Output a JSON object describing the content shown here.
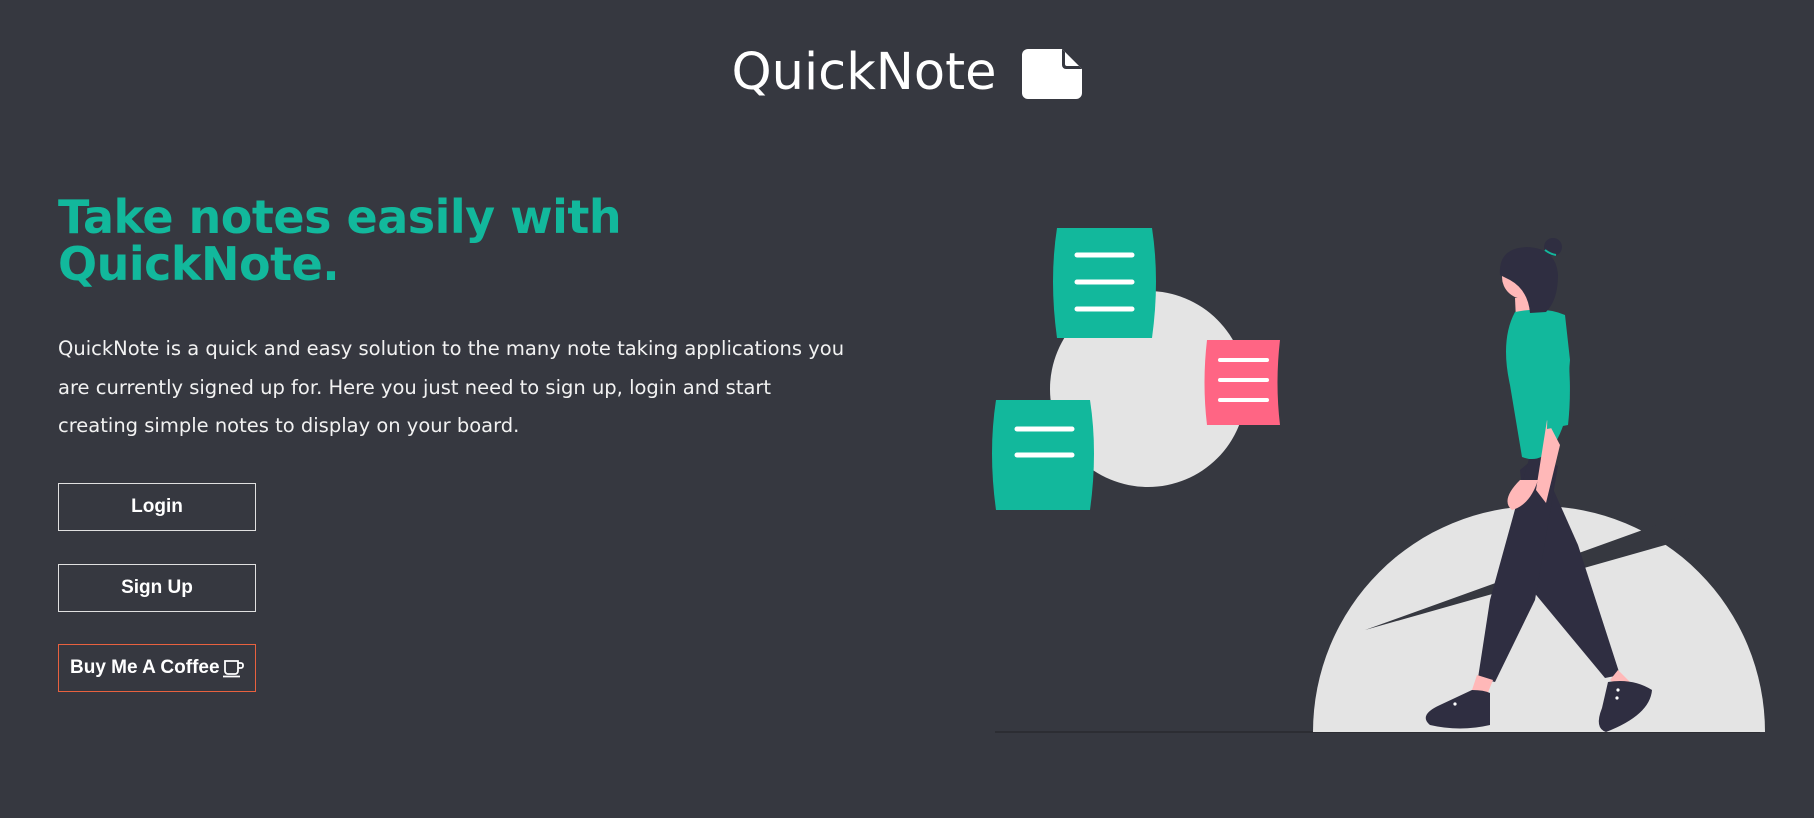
{
  "header": {
    "brand_name": "QuickNote",
    "brand_icon": "note-icon"
  },
  "hero": {
    "title": "Take notes easily with QuickNote.",
    "description": "QuickNote is a quick and easy solution to the many note taking applications you are currently signed up for. Here you just need to sign up, login and start creating simple notes to display on your board."
  },
  "actions": {
    "login_label": "Login",
    "signup_label": "Sign Up",
    "coffee_label": "Buy Me A Coffee",
    "coffee_icon": "coffee-cup-icon"
  },
  "illustration": {
    "name": "woman-walking-with-notes-illustration"
  },
  "colors": {
    "background": "#363840",
    "accent": "#12b89c",
    "note_pink": "#ff6584",
    "coffee_border": "#e8613f",
    "circle_gray": "#e4e4e4",
    "figure_dark": "#2f2e41"
  }
}
